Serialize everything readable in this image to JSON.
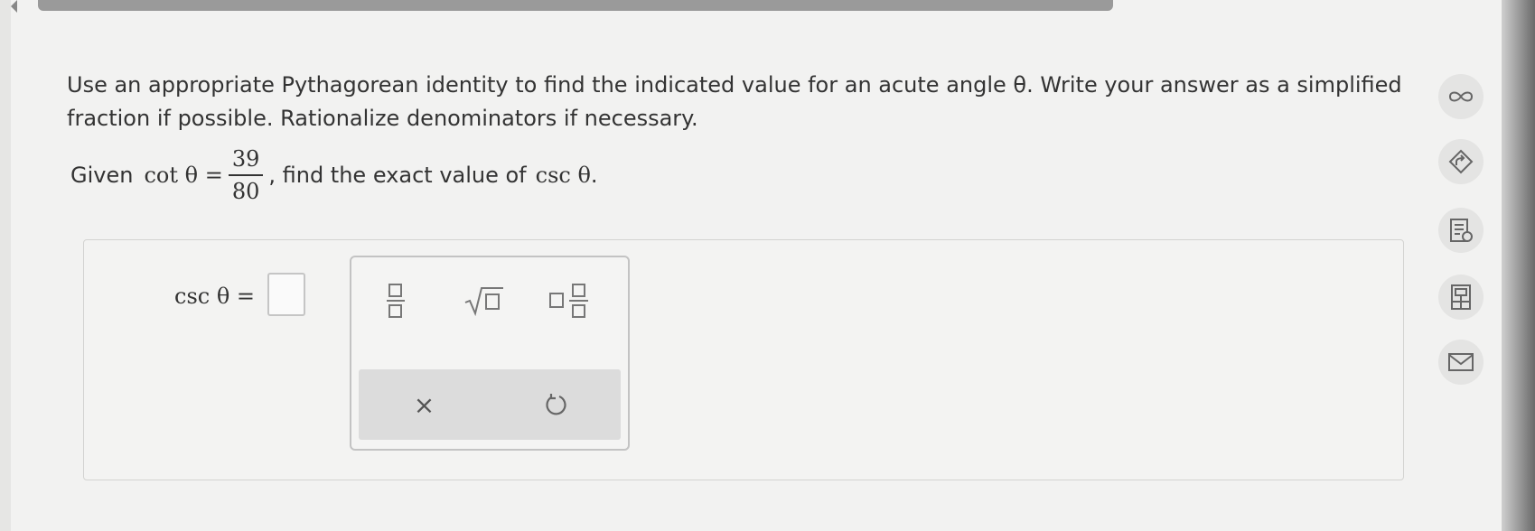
{
  "instructions": "Use an appropriate Pythagorean identity to find the indicated value for an acute angle θ. Write your answer as a simplified fraction if possible. Rationalize denominators if necessary.",
  "given": {
    "prefix": "Given",
    "function": "cot θ =",
    "numerator": "39",
    "denominator": "80",
    "suffix_text": ", find the exact value of",
    "target": "csc θ",
    "period": "."
  },
  "answer": {
    "label": "csc θ =",
    "value": ""
  },
  "toolbar": {
    "buttons": [
      "fraction",
      "square-root",
      "mixed-number"
    ],
    "clear_symbol": "×",
    "undo_symbol": "↺"
  },
  "side_tools": [
    "infinity-icon",
    "share-icon",
    "notes-icon",
    "calculator-icon",
    "mail-icon"
  ],
  "colors": {
    "background": "#f2f2f1",
    "text": "#333333",
    "accent": "#777777"
  }
}
